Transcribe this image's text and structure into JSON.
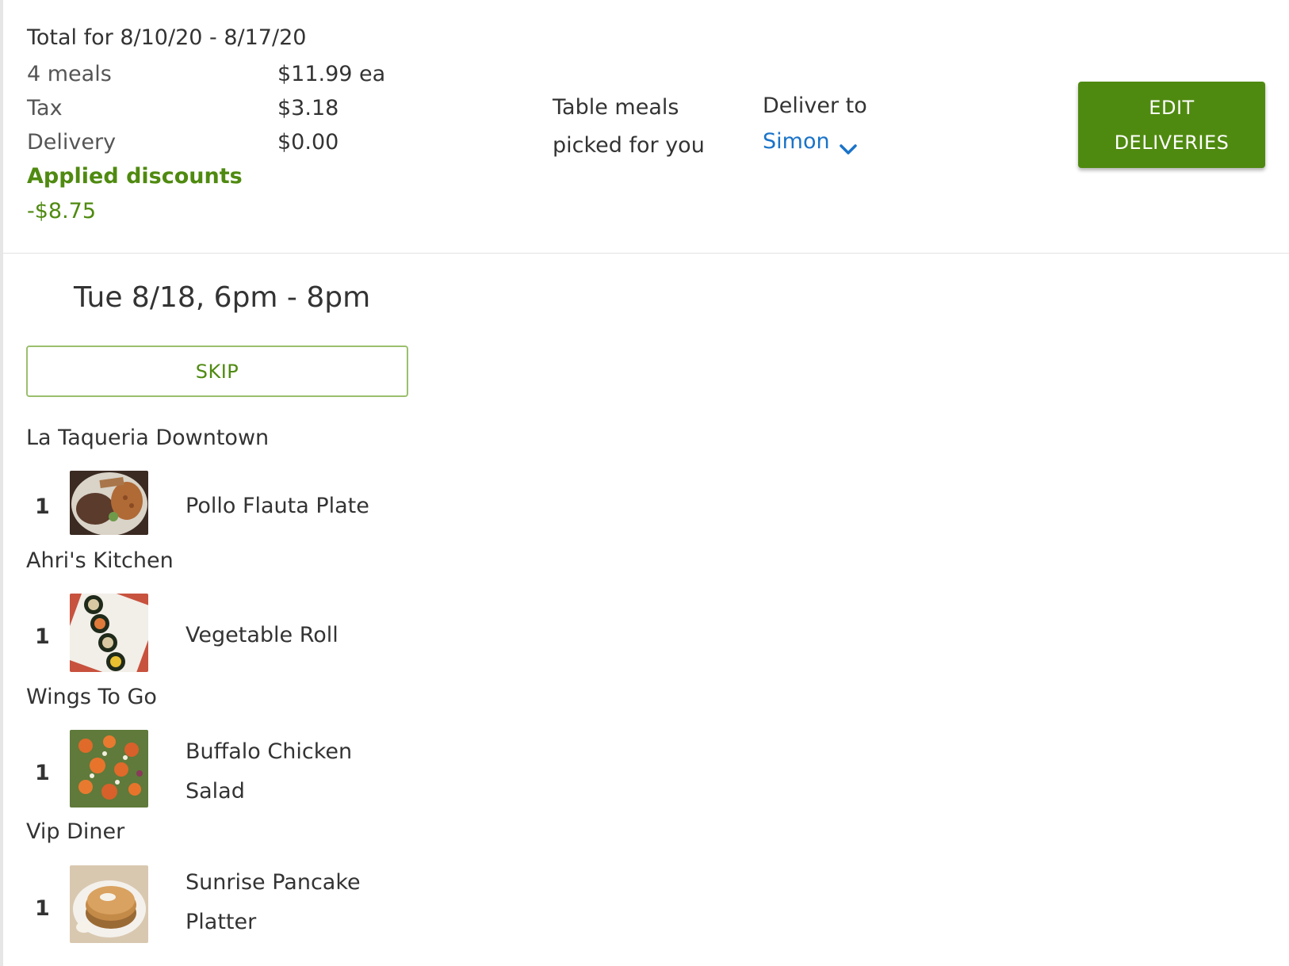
{
  "summary": {
    "title": "Total for 8/10/20 - 8/17/20",
    "lines": [
      {
        "label": "4 meals",
        "value": "$11.99 ea"
      },
      {
        "label": "Tax",
        "value": "$3.18"
      },
      {
        "label": "Delivery",
        "value": "$0.00"
      }
    ],
    "discount_title": "Applied discounts",
    "discount_value": "-$8.75",
    "plan_text": "Table meals picked for you",
    "deliver_label": "Deliver to",
    "deliver_value": "Simon",
    "edit_button": "EDIT DELIVERIES"
  },
  "delivery": {
    "date": "Tue 8/18, 6pm - 8pm",
    "skip_label": "SKIP",
    "orders": [
      {
        "restaurant": "La Taqueria Downtown",
        "qty": "1",
        "item": "Pollo Flauta Plate",
        "image_icon": "flauta-plate-photo"
      },
      {
        "restaurant": "Ahri's Kitchen",
        "qty": "1",
        "item": "Vegetable Roll",
        "image_icon": "vegetable-roll-photo"
      },
      {
        "restaurant": "Wings To Go",
        "qty": "1",
        "item": "Buffalo Chicken Salad",
        "image_icon": "buffalo-salad-photo"
      },
      {
        "restaurant": "Vip Diner",
        "qty": "1",
        "item": "Sunrise Pancake Platter",
        "image_icon": "pancake-platter-photo"
      }
    ]
  },
  "colors": {
    "brand_green": "#4f8a10",
    "link_blue": "#1a73c9",
    "text": "#333333"
  }
}
